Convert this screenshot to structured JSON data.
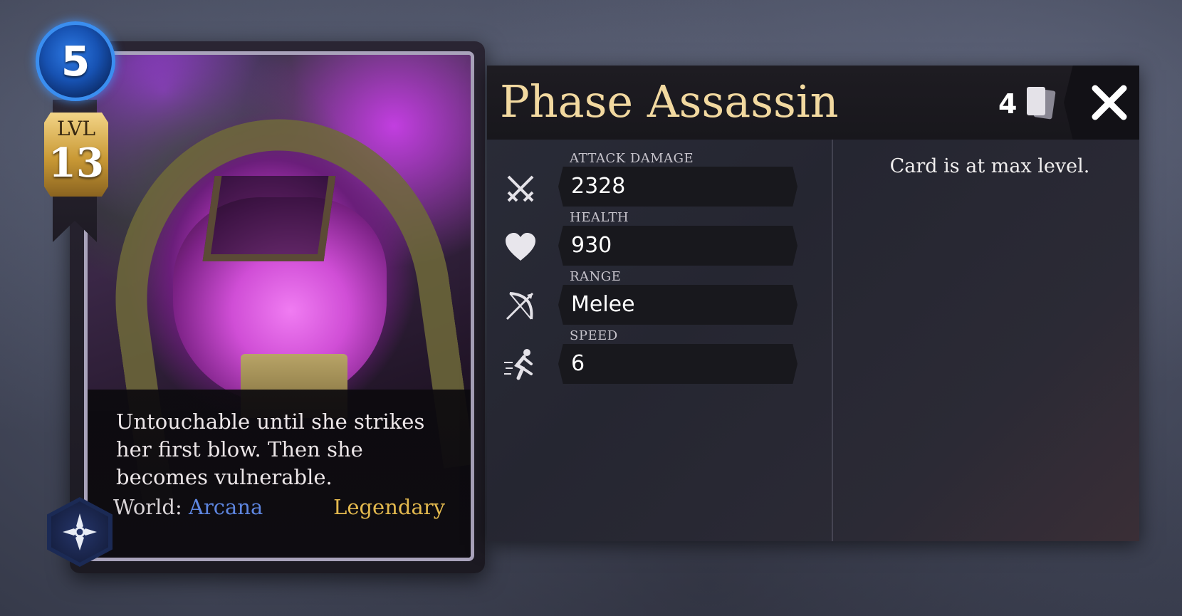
{
  "card": {
    "cost": "5",
    "level_label": "LVL",
    "level_value": "13",
    "description": "Untouchable until she strikes her first blow. Then she becomes vulnerable.",
    "world_label": "World:",
    "world_value": "Arcana",
    "rarity": "Legendary"
  },
  "panel": {
    "title": "Phase Assassin",
    "copies": "4",
    "max_level_text": "Card is at max level.",
    "stats": [
      {
        "label": "ATTACK DAMAGE",
        "value": "2328",
        "icon": "crossed-swords-icon"
      },
      {
        "label": "HEALTH",
        "value": "930",
        "icon": "heart-icon"
      },
      {
        "label": "RANGE",
        "value": "Melee",
        "icon": "bow-icon"
      },
      {
        "label": "SPEED",
        "value": "6",
        "icon": "running-figure-icon"
      }
    ]
  },
  "colors": {
    "title_gold": "#f2d9a0",
    "world_blue": "#5e86e0",
    "rarity_gold": "#e3b94e",
    "cost_blue": "#1752b2"
  }
}
